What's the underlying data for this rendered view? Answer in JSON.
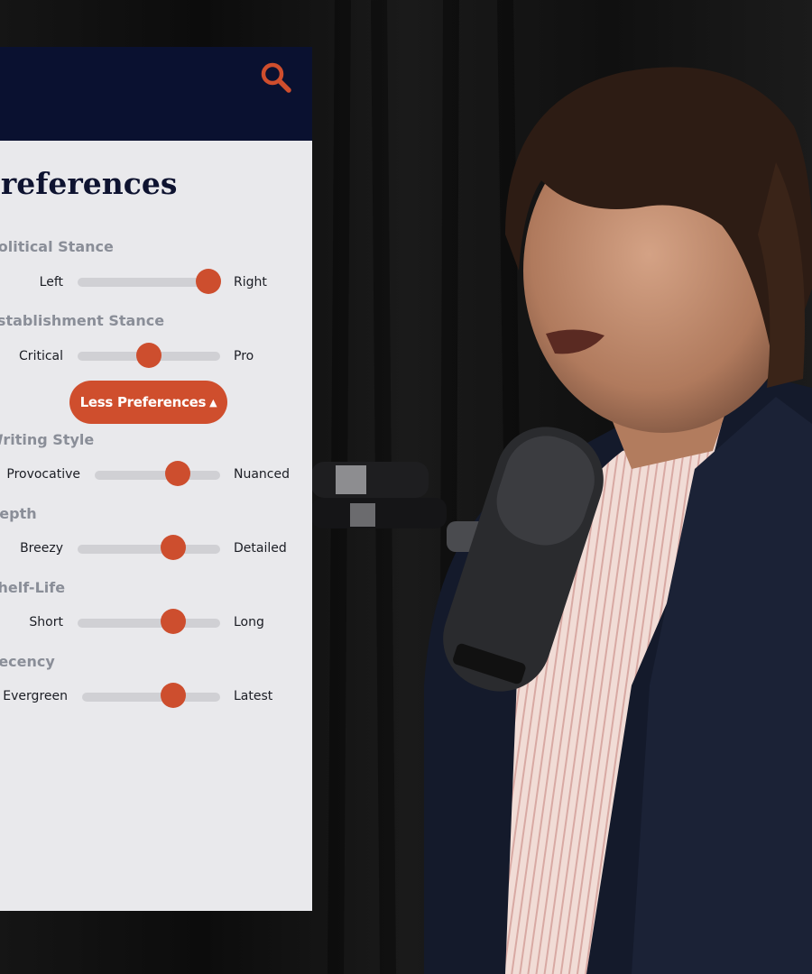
{
  "header": {
    "search_icon": "search-icon"
  },
  "page": {
    "title": "Preferences"
  },
  "sliders": [
    {
      "id": "political-stance",
      "label": "Political Stance",
      "left": "Left",
      "right": "Right",
      "value": 0.92
    },
    {
      "id": "establishment-stance",
      "label": "Establishment Stance",
      "left": "Critical",
      "right": "Pro",
      "value": 0.5
    },
    {
      "id": "writing-style",
      "label": "Writing Style",
      "left": "Provocative",
      "right": "Nuanced",
      "value": 0.66
    },
    {
      "id": "depth",
      "label": "Depth",
      "left": "Breezy",
      "right": "Detailed",
      "value": 0.67
    },
    {
      "id": "shelf-life",
      "label": "Shelf-Life",
      "left": "Short",
      "right": "Long",
      "value": 0.67
    },
    {
      "id": "recency",
      "label": "Recency",
      "left": "Evergreen",
      "right": "Latest",
      "value": 0.66
    }
  ],
  "toggle_button": {
    "label": "Less Preferences",
    "icon": "chevron-up-icon"
  },
  "colors": {
    "header_bg": "#0a1130",
    "panel_bg": "#e9e9ec",
    "accent": "#cd4e2e",
    "track": "#d0d0d4",
    "title": "#0e1330",
    "group_label": "#8a8e98"
  }
}
